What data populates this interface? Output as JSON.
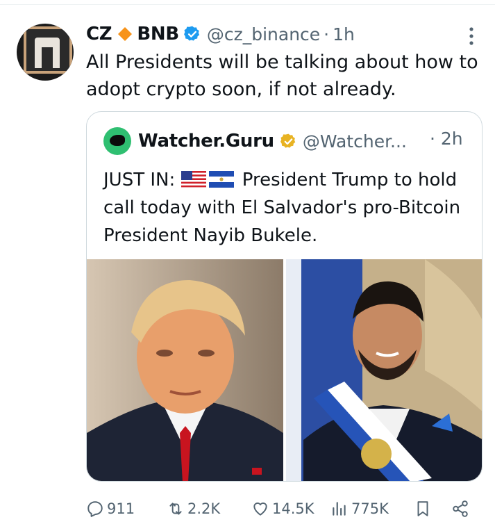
{
  "tweet": {
    "author": {
      "name": "CZ",
      "name_suffix": "BNB",
      "handle": "@cz_binance",
      "separator": "·",
      "time": "1h",
      "avatar_icon": "binance-gate-logo"
    },
    "text": "All Presidents will be talking about how to adopt crypto soon, if not already.",
    "quote": {
      "author": {
        "name": "Watcher.Guru",
        "handle": "@Watcher...",
        "separator": "·",
        "time": "2h",
        "badge": "gold-verified-icon"
      },
      "text_prefix": "JUST IN:",
      "flags": [
        "us-flag-icon",
        "el-salvador-flag-icon"
      ],
      "text_body": "President Trump to hold call today with El Salvador's pro-Bitcoin President Nayib Bukele.",
      "images": [
        "trump-portrait",
        "bukele-portrait"
      ]
    },
    "actions": {
      "replies": "911",
      "reposts": "2.2K",
      "likes": "14.5K",
      "views": "775K"
    }
  },
  "colors": {
    "text_primary": "#0f1419",
    "text_secondary": "#536471",
    "verified_blue": "#1d9bf0",
    "gold_badge": "#e8b323",
    "bnb_orange": "#f7931a",
    "border": "#cfd9de"
  }
}
